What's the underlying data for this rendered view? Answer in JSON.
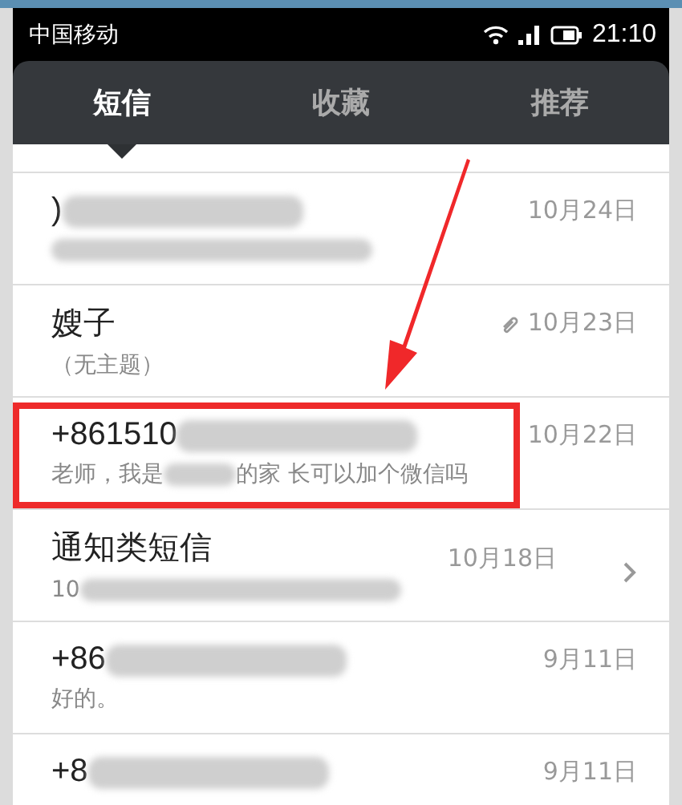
{
  "status_bar": {
    "carrier": "中国移动",
    "time": "21:10"
  },
  "tabs": [
    {
      "label": "短信",
      "selected": true
    },
    {
      "label": "收藏",
      "selected": false
    },
    {
      "label": "推荐",
      "selected": false
    }
  ],
  "rows": [
    {
      "name": ")",
      "preview_start": "",
      "preview_end": "",
      "date": "10月24日",
      "name_blurred": true,
      "preview_blurred": true,
      "attachment": false,
      "chevron": false,
      "highlighted": false
    },
    {
      "name": "嫂子",
      "preview_start": "（无主题）",
      "preview_end": "",
      "date": "10月23日",
      "name_blurred": false,
      "preview_blurred": false,
      "attachment": true,
      "chevron": false,
      "highlighted": false
    },
    {
      "name": "+861510",
      "preview_start": "老师，我是",
      "preview_end": "的家 长可以加个微信吗",
      "date": "10月22日",
      "name_blurred": true,
      "preview_blurred": true,
      "attachment": false,
      "chevron": false,
      "highlighted": true
    },
    {
      "name": "通知类短信",
      "preview_start": "10",
      "preview_end": "",
      "date": "10月18日",
      "name_blurred": false,
      "preview_blurred": true,
      "attachment": false,
      "chevron": true,
      "highlighted": false
    },
    {
      "name": "+86",
      "preview_start": "好的。",
      "preview_end": "",
      "date": "9月11日",
      "name_blurred": true,
      "preview_blurred": false,
      "attachment": false,
      "chevron": false,
      "highlighted": false
    },
    {
      "name": "+8",
      "preview_start": "",
      "preview_end": "",
      "date": "9月11日",
      "name_blurred": true,
      "preview_blurred": false,
      "attachment": false,
      "chevron": false,
      "highlighted": false
    }
  ]
}
